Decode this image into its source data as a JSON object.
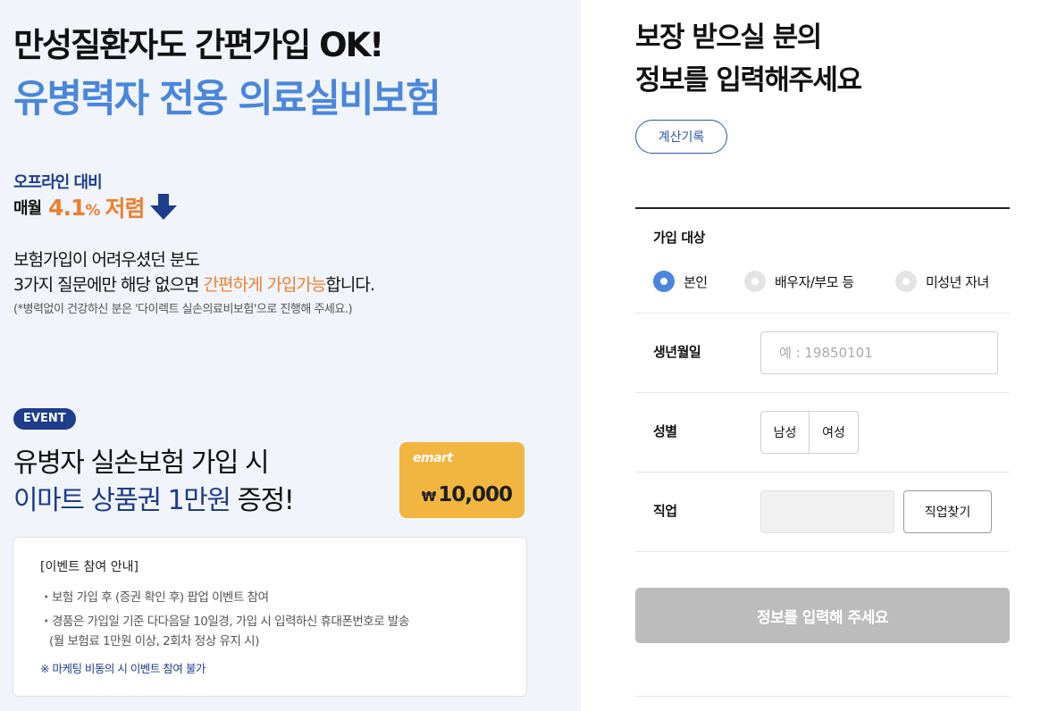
{
  "hero": {
    "line1": "만성질환자도 간편가입 OK!",
    "line2": "유병력자 전용 의료실비보험"
  },
  "discount": {
    "offline_label": "오프라인 대비",
    "monthly_label": "매월",
    "percent_value": "4.1",
    "percent_sign": "%",
    "down_label": "저렴",
    "arrow_icon": "down-arrow-icon"
  },
  "description": {
    "line1": "보험가입이 어려우셨던 분도",
    "line2_prefix": "3가지 질문에만 해당 없으면 ",
    "line2_highlight": "간편하게 가입가능",
    "line2_suffix": "합니다.",
    "note": "(*병력없이 건강하신 분은 '다이렉트 실손의료비보험'으로 진행해 주세요.)"
  },
  "event": {
    "badge": "EVENT",
    "line1": "유병자 실손보험 가입 시",
    "line2_blue": "이마트 상품권 1만원",
    "line2_rest": " 증정!",
    "card_brand": "emart",
    "card_currency": "₩",
    "card_amount": "10,000"
  },
  "info_box": {
    "title": "[이벤트 참여 안내]",
    "item1": "・보험 가입 후 (증권 확인 후) 팝업 이벤트 참여",
    "item2": "・경품은 가입일 기준 다다음달 10일경, 가입 시 입력하신 휴대폰번호로 발송",
    "item2_sub": "(월 보험료 1만원 이상, 2회차 정상 유지 시)",
    "warning": "※ 마케팅 비동의 시 이벤트 참여 불가"
  },
  "form": {
    "title_line1": "보장 받으실 분의",
    "title_line2": "정보를 입력해주세요",
    "history_button": "계산기록",
    "target_label": "가입 대상",
    "targets": [
      {
        "label": "본인",
        "selected": true
      },
      {
        "label": "배우자/부모 등",
        "selected": false
      },
      {
        "label": "미성년 자녀",
        "selected": false
      }
    ],
    "birth_label": "생년월일",
    "birth_placeholder": "예 : 19850101",
    "gender_label": "성별",
    "gender_male": "남성",
    "gender_female": "여성",
    "job_label": "직업",
    "job_value": "",
    "job_button": "직업찾기",
    "submit_button": "정보를 입력해 주세요"
  },
  "colors": {
    "accent_blue": "#4a86dc",
    "navy": "#1e3d8c",
    "orange": "#ee7f2e",
    "card_yellow": "#f2b640",
    "disabled_gray": "#bcbcbc"
  }
}
